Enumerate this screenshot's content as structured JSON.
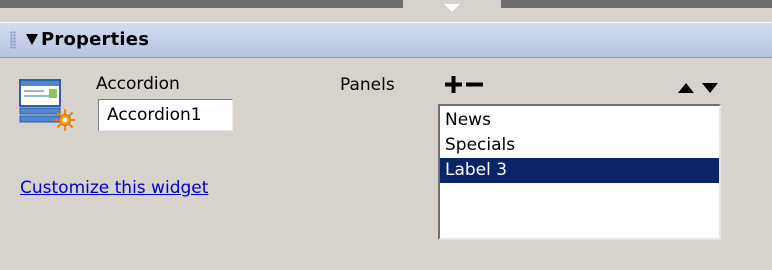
{
  "header": {
    "title": "Properties",
    "collapse_icon": "triangle-down-icon",
    "gripper_icon": "gripper-dots-icon",
    "colors": {
      "header_gradient_top": "#d3dcee",
      "header_gradient_bottom": "#b6c4e1",
      "panel_background": "#d7d3cc"
    }
  },
  "widget": {
    "icon": "accordion-widget-icon",
    "type_label": "Accordion",
    "name_value": "Accordion1",
    "customize_link": "Customize this widget",
    "link_color": "#0000cc"
  },
  "panels": {
    "label": "Panels",
    "add_icon": "plus-icon",
    "remove_icon": "minus-icon",
    "move_up_icon": "arrow-up-icon",
    "move_down_icon": "arrow-down-icon",
    "items": [
      {
        "label": "News",
        "selected": false
      },
      {
        "label": "Specials",
        "selected": false
      },
      {
        "label": "Label 3",
        "selected": true
      }
    ],
    "selection_color": "#0a246a"
  }
}
